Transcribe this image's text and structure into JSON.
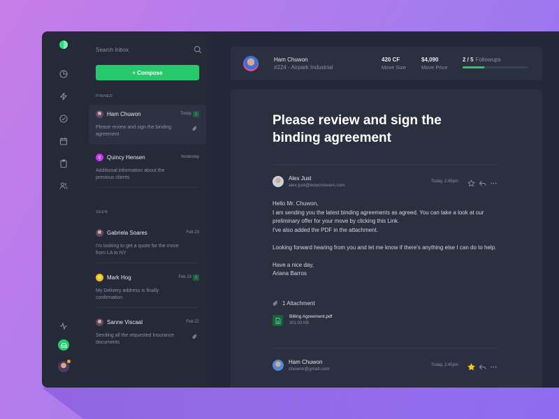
{
  "rail": {
    "icons": [
      "pie-chart-icon",
      "bolt-icon",
      "check-circle-icon",
      "calendar-icon",
      "clipboard-icon",
      "users-icon",
      "activity-icon",
      "inbox-icon"
    ]
  },
  "inbox": {
    "search_placeholder": "Search Inbox",
    "compose_label": "+ Compose",
    "pinned_label": "PINNED",
    "seen_label": "SEEN",
    "pinned": [
      {
        "name": "Ham Chuwon",
        "date": "Today",
        "badge": "2",
        "preview": "Please review and sign the binding agreement",
        "attachment": true
      },
      {
        "name": "Quincy Hensen",
        "date": "Yesterday",
        "avatar_letter": "Q",
        "preview": "Additional information about the previous clients",
        "attachment": false
      }
    ],
    "seen": [
      {
        "name": "Gabriela Soares",
        "date": "Feb 23",
        "preview": "I'm looking to get a quote for the move from LA to NY",
        "attachment": false
      },
      {
        "name": "Mark Hog",
        "date": "Feb 23",
        "badge": "3",
        "avatar_letter": "M",
        "preview": "My Delivery address is finally confirmation",
        "attachment": false
      },
      {
        "name": "Sanne Viscaal",
        "date": "Feb 22",
        "preview": "Sending all the requested Insurance documents",
        "attachment": true
      }
    ]
  },
  "header": {
    "name": "Ham Chuwon",
    "subtitle": "#224 -  Airpark Industrial",
    "move_size_value": "420 CF",
    "move_size_label": "Move Size",
    "move_price_value": "$4,090",
    "move_price_label": "Move Price",
    "followups_value": "2 / 5",
    "followups_label": "Followups",
    "followups_progress": 0.33
  },
  "mail": {
    "subject": "Please review and sign the binding agreement",
    "messages": [
      {
        "sender": "Alex Just",
        "email": "alex.just@ecwcmovers.com",
        "time": "Today, 2:45pm",
        "starred": false,
        "body": [
          "Hello Mr. Chuwon,",
          "I am sending you the latest binding agreements as agreed. You can take a look at our preliminary offer for your move by clicking this Link.",
          "I've also added the PDF in the attachment.",
          "",
          "Looking forward hearing from you and let me know if there's anything else I can do to help.",
          "",
          "Have a nice day,",
          "Ariana Barros"
        ],
        "attachments_label": "1 Attachment",
        "attachment": {
          "name": "Billing Agreement.pdf",
          "size": "301.03 KB"
        }
      },
      {
        "sender": "Ham Chuwon",
        "email": "chuwon@gmail.com",
        "time": "Today, 2:45pm",
        "starred": true
      }
    ]
  },
  "colors": {
    "accent": "#27c96d",
    "star": "#f5c518",
    "panel": "#262a38"
  }
}
